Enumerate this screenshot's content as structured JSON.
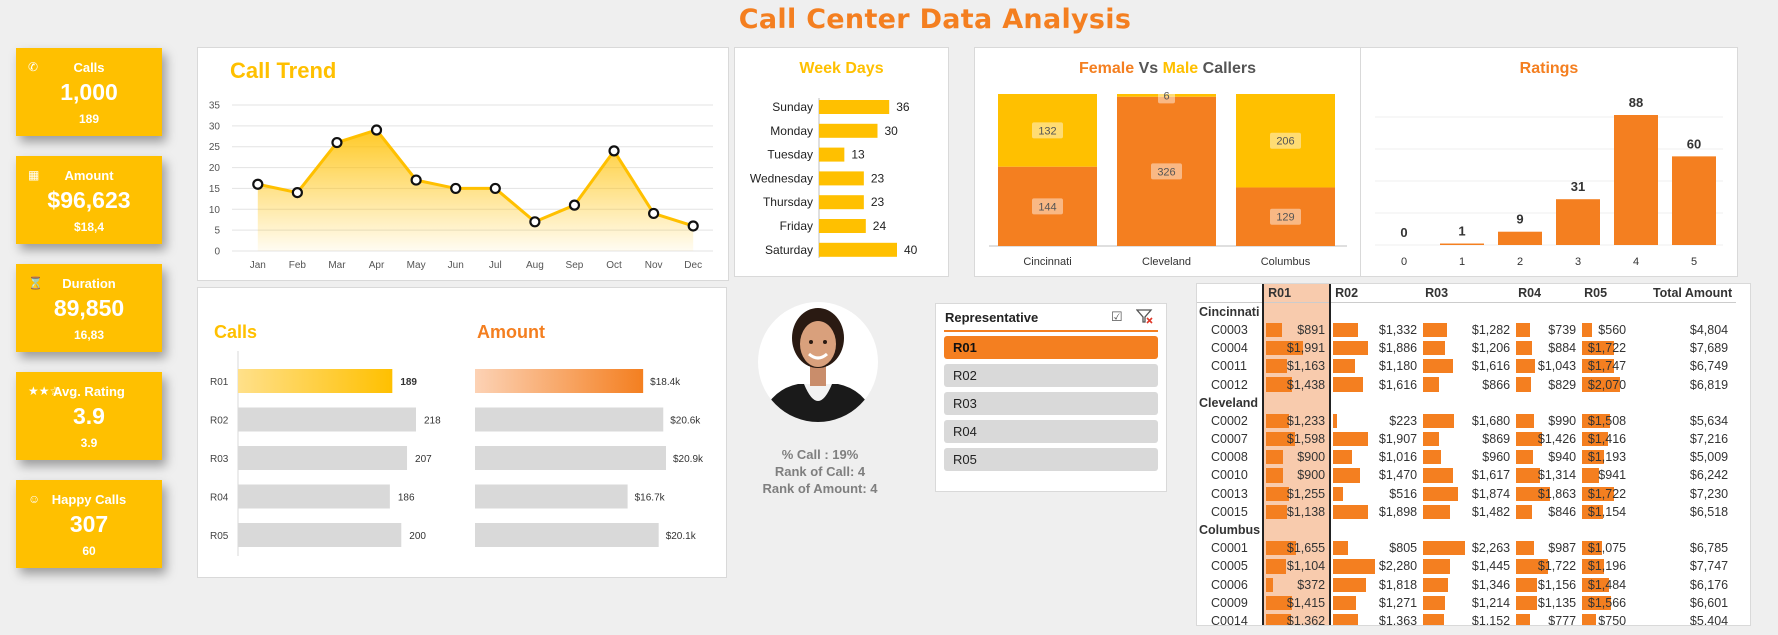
{
  "title": "Call Center Data Analysis",
  "colors": {
    "yellow": "#ffc000",
    "orange": "#f47f20",
    "gray": "#d9d9d9",
    "pale": "#f8cbad"
  },
  "cards": [
    {
      "label": "Calls",
      "icon": "phone-icon",
      "glyph": "✆",
      "value": "1,000",
      "sub": "189"
    },
    {
      "label": "Amount",
      "icon": "cart-icon",
      "glyph": "▦",
      "value": "$96,623",
      "sub": "$18,4"
    },
    {
      "label": "Duration",
      "icon": "hourglass-icon",
      "glyph": "⌛",
      "value": "89,850",
      "sub": "16,83"
    },
    {
      "label": "Avg. Rating",
      "icon": "stars-icon",
      "glyph": "★★☆",
      "value": "3.9",
      "sub": "3.9"
    },
    {
      "label": "Happy Calls",
      "icon": "smiley-icon",
      "glyph": "☺",
      "value": "307",
      "sub": "60"
    }
  ],
  "call_trend": {
    "title": "Call Trend"
  },
  "weekdays": {
    "title": "Week Days"
  },
  "gender": {
    "title_female": "Female",
    "title_vs": "Vs",
    "title_male": "Male",
    "title_callers": "Callers"
  },
  "ratings": {
    "title": "Ratings"
  },
  "rep_bars": {
    "calls_title": "Calls",
    "amount_title": "Amount"
  },
  "profile": {
    "pct_call": "% Call : 19%",
    "rank_call": "Rank of Call: 4",
    "rank_amount": "Rank of Amount: 4"
  },
  "slicer": {
    "title": "Representative",
    "items": [
      "R01",
      "R02",
      "R03",
      "R04",
      "R05"
    ],
    "selected": "R01"
  },
  "matrix": {
    "headers": [
      "",
      "R01",
      "R02",
      "R03",
      "R04",
      "R05",
      "Total Amount"
    ],
    "groups": [
      {
        "name": "Cincinnati",
        "rows": [
          {
            "id": "C0003",
            "vals": [
              "$891",
              "$1,332",
              "$1,282",
              "$739",
              "$560"
            ],
            "nums": [
              891,
              1332,
              1282,
              739,
              560
            ],
            "total": "$4,804"
          },
          {
            "id": "C0004",
            "vals": [
              "$1,991",
              "$1,886",
              "$1,206",
              "$884",
              "$1,722"
            ],
            "nums": [
              1991,
              1886,
              1206,
              884,
              1722
            ],
            "total": "$7,689"
          },
          {
            "id": "C0011",
            "vals": [
              "$1,163",
              "$1,180",
              "$1,616",
              "$1,043",
              "$1,747"
            ],
            "nums": [
              1163,
              1180,
              1616,
              1043,
              1747
            ],
            "total": "$6,749"
          },
          {
            "id": "C0012",
            "vals": [
              "$1,438",
              "$1,616",
              "$866",
              "$829",
              "$2,070"
            ],
            "nums": [
              1438,
              1616,
              866,
              829,
              2070
            ],
            "total": "$6,819"
          }
        ]
      },
      {
        "name": "Cleveland",
        "rows": [
          {
            "id": "C0002",
            "vals": [
              "$1,233",
              "$223",
              "$1,680",
              "$990",
              "$1,508"
            ],
            "nums": [
              1233,
              223,
              1680,
              990,
              1508
            ],
            "total": "$5,634"
          },
          {
            "id": "C0007",
            "vals": [
              "$1,598",
              "$1,907",
              "$869",
              "$1,426",
              "$1,416"
            ],
            "nums": [
              1598,
              1907,
              869,
              1426,
              1416
            ],
            "total": "$7,216"
          },
          {
            "id": "C0008",
            "vals": [
              "$900",
              "$1,016",
              "$960",
              "$940",
              "$1,193"
            ],
            "nums": [
              900,
              1016,
              960,
              940,
              1193
            ],
            "total": "$5,009"
          },
          {
            "id": "C0010",
            "vals": [
              "$900",
              "$1,470",
              "$1,617",
              "$1,314",
              "$941"
            ],
            "nums": [
              900,
              1470,
              1617,
              1314,
              941
            ],
            "total": "$6,242"
          },
          {
            "id": "C0013",
            "vals": [
              "$1,255",
              "$516",
              "$1,874",
              "$1,863",
              "$1,722"
            ],
            "nums": [
              1255,
              516,
              1874,
              1863,
              1722
            ],
            "total": "$7,230"
          },
          {
            "id": "C0015",
            "vals": [
              "$1,138",
              "$1,898",
              "$1,482",
              "$846",
              "$1,154"
            ],
            "nums": [
              1138,
              1898,
              1482,
              846,
              1154
            ],
            "total": "$6,518"
          }
        ]
      },
      {
        "name": "Columbus",
        "rows": [
          {
            "id": "C0001",
            "vals": [
              "$1,655",
              "$805",
              "$2,263",
              "$987",
              "$1,075"
            ],
            "nums": [
              1655,
              805,
              2263,
              987,
              1075
            ],
            "total": "$6,785"
          },
          {
            "id": "C0005",
            "vals": [
              "$1,104",
              "$2,280",
              "$1,445",
              "$1,722",
              "$1,196"
            ],
            "nums": [
              1104,
              2280,
              1445,
              1722,
              1196
            ],
            "total": "$7,747"
          },
          {
            "id": "C0006",
            "vals": [
              "$372",
              "$1,818",
              "$1,346",
              "$1,156",
              "$1,484"
            ],
            "nums": [
              372,
              1818,
              1346,
              1156,
              1484
            ],
            "total": "$6,176"
          },
          {
            "id": "C0009",
            "vals": [
              "$1,415",
              "$1,271",
              "$1,214",
              "$1,135",
              "$1,566"
            ],
            "nums": [
              1415,
              1271,
              1214,
              1135,
              1566
            ],
            "total": "$6,601"
          },
          {
            "id": "C0014",
            "vals": [
              "$1,362",
              "$1,363",
              "$1,152",
              "$777",
              "$750"
            ],
            "nums": [
              1362,
              1363,
              1152,
              777,
              750
            ],
            "total": "$5,404"
          }
        ]
      }
    ]
  },
  "chart_data": [
    {
      "type": "area",
      "title": "Call Trend",
      "categories": [
        "Jan",
        "Feb",
        "Mar",
        "Apr",
        "May",
        "Jun",
        "Jul",
        "Aug",
        "Sep",
        "Oct",
        "Nov",
        "Dec"
      ],
      "values": [
        16,
        14,
        26,
        29,
        17,
        15,
        15,
        7,
        11,
        24,
        9,
        6
      ],
      "ylim": [
        0,
        35
      ],
      "yticks": [
        0,
        5,
        10,
        15,
        20,
        25,
        30,
        35
      ],
      "grid": true
    },
    {
      "type": "bar",
      "orientation": "horizontal",
      "title": "Week Days",
      "categories": [
        "Sunday",
        "Monday",
        "Tuesday",
        "Wednesday",
        "Thursday",
        "Friday",
        "Saturday"
      ],
      "values": [
        36,
        30,
        13,
        23,
        23,
        24,
        40
      ]
    },
    {
      "type": "bar",
      "stacked": true,
      "title": "Female Vs Male Callers",
      "categories": [
        "Cincinnati",
        "Cleveland",
        "Columbus"
      ],
      "series": [
        {
          "name": "Female",
          "values": [
            144,
            326,
            129
          ]
        },
        {
          "name": "Male",
          "values": [
            132,
            6,
            206
          ]
        }
      ]
    },
    {
      "type": "bar",
      "title": "Ratings",
      "categories": [
        "0",
        "1",
        "2",
        "3",
        "4",
        "5"
      ],
      "values": [
        0,
        1,
        9,
        31,
        88,
        60
      ]
    },
    {
      "type": "bar",
      "orientation": "horizontal",
      "title": "Calls",
      "categories": [
        "R01",
        "R02",
        "R03",
        "R04",
        "R05"
      ],
      "values": [
        189,
        218,
        207,
        186,
        200
      ],
      "labels": [
        "189",
        "218",
        "207",
        "186",
        "200"
      ]
    },
    {
      "type": "bar",
      "orientation": "horizontal",
      "title": "Amount",
      "categories": [
        "R01",
        "R02",
        "R03",
        "R04",
        "R05"
      ],
      "values": [
        18.4,
        20.6,
        20.9,
        16.7,
        20.1
      ],
      "labels": [
        "$18.4k",
        "$20.6k",
        "$20.9k",
        "$16.7k",
        "$20.1k"
      ]
    }
  ]
}
